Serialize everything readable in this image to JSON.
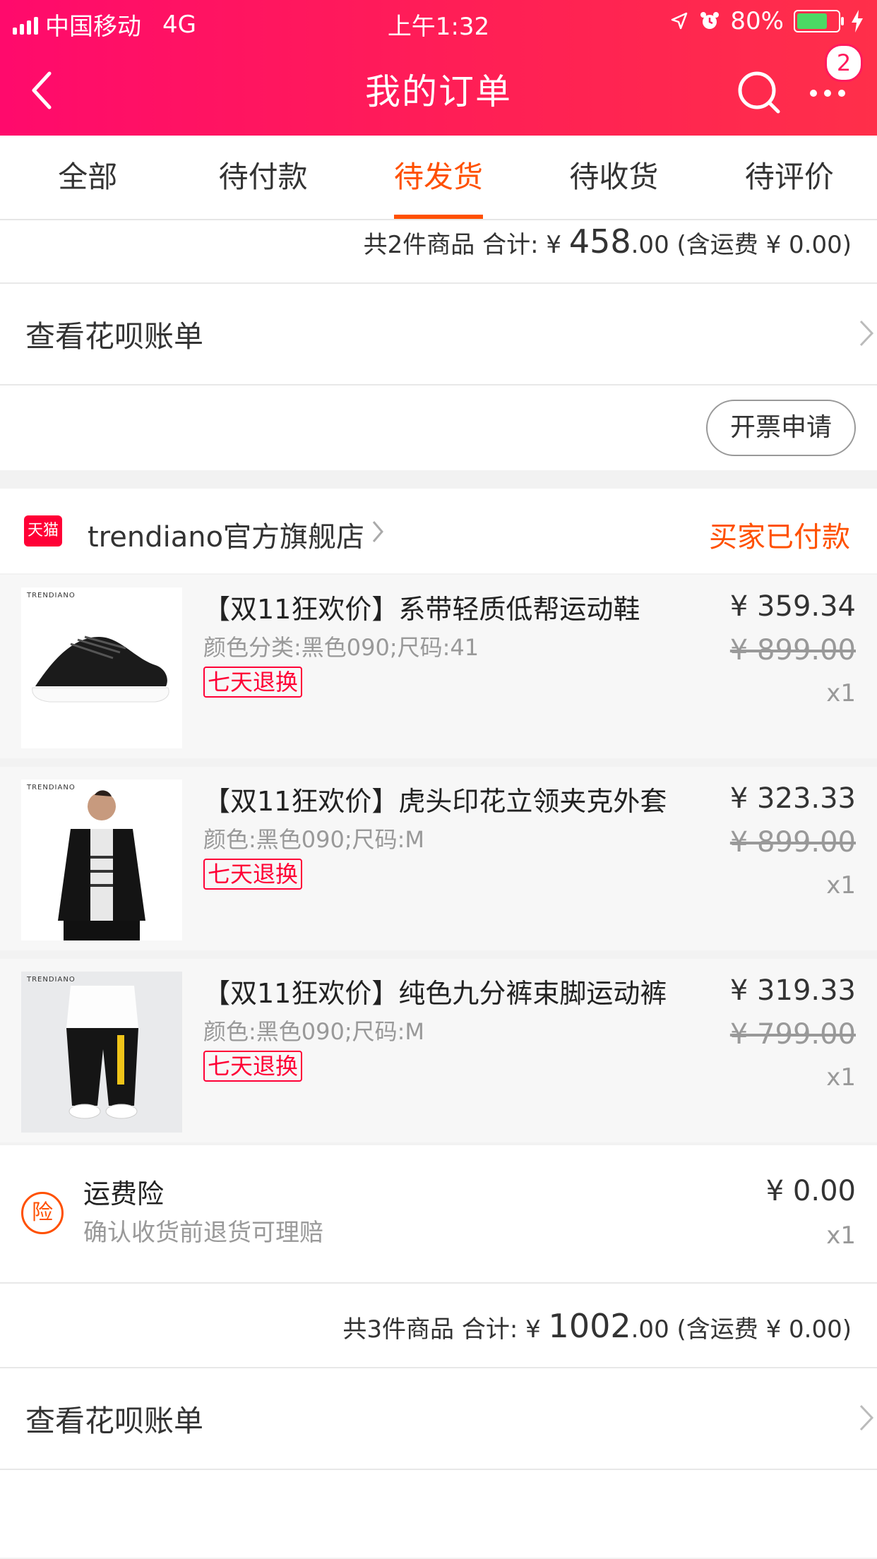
{
  "status_bar": {
    "carrier": "中国移动",
    "network": "4G",
    "time": "上午1:32",
    "battery": "80%"
  },
  "nav": {
    "title": "我的订单",
    "badge": "2"
  },
  "tabs": [
    "全部",
    "待付款",
    "待发货",
    "待收货",
    "待评价"
  ],
  "active_tab": "待发货",
  "order1": {
    "summary_prefix": "共2件商品 合计: ¥ ",
    "total_int": "458",
    "total_dec": ".00",
    "shipping": " (含运费 ¥ 0.00)",
    "huabei": "查看花呗账单",
    "invoice": "开票申请"
  },
  "order2": {
    "shop_logo": "天猫",
    "shop_name": "trendiano官方旗舰店",
    "status": "买家已付款",
    "items": [
      {
        "name": "【双11狂欢价】系带轻质低帮运动鞋",
        "spec": "颜色分类:黑色090;尺码:41",
        "tag": "七天退换",
        "price": "¥ 359.34",
        "orig": "¥ 899.00",
        "qty": "x1",
        "brand": "TRENDIANO"
      },
      {
        "name": "【双11狂欢价】虎头印花立领夹克外套",
        "spec": "颜色:黑色090;尺码:M",
        "tag": "七天退换",
        "price": "¥ 323.33",
        "orig": "¥ 899.00",
        "qty": "x1",
        "brand": "TRENDIANO"
      },
      {
        "name": "【双11狂欢价】纯色九分裤束脚运动裤",
        "spec": "颜色:黑色090;尺码:M",
        "tag": "七天退换",
        "price": "¥ 319.33",
        "orig": "¥ 799.00",
        "qty": "x1",
        "brand": "TRENDIANO"
      }
    ],
    "insurance": {
      "icon_text": "险",
      "title": "运费险",
      "desc": "确认收货前退货可理赔",
      "price": "¥ 0.00",
      "qty": "x1"
    },
    "summary_prefix": "共3件商品 合计: ¥ ",
    "total_int": "1002",
    "total_dec": ".00",
    "shipping": " (含运费 ¥ 0.00)",
    "huabei": "查看花呗账单"
  },
  "colors": {
    "header": "#ff1a5c",
    "accent": "#ff5000",
    "tmall": "#ff0036"
  }
}
